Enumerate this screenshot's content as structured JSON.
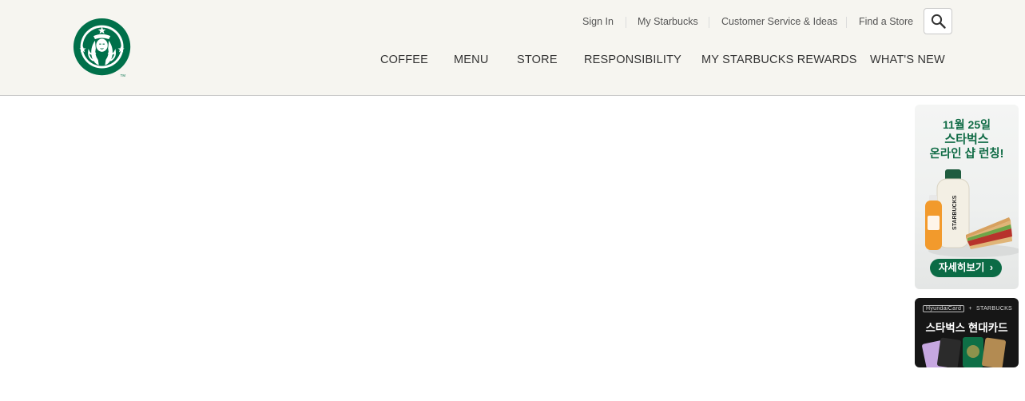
{
  "brand": {
    "logo_name": "starbucks-siren-logo",
    "green": "#00704a"
  },
  "util_nav": {
    "sign_in": "Sign In",
    "my_starbucks": "My Starbucks",
    "customer_service": "Customer Service & Ideas",
    "find_store": "Find a Store"
  },
  "search": {
    "icon": "search-icon"
  },
  "main_nav": {
    "coffee": "COFFEE",
    "menu": "MENU",
    "store": "STORE",
    "responsibility": "RESPONSIBILITY",
    "rewards": "MY STARBUCKS REWARDS",
    "whats_new": "WHAT'S NEW"
  },
  "banners": {
    "launch": {
      "line1": "11월 25일",
      "line2": "스타벅스",
      "line3": "온라인 샵 런칭!",
      "button": "자세히보기",
      "bottle_label": "STARBUCKS"
    },
    "card": {
      "partner": "HyundaiCard",
      "plus": "+",
      "brand": "STARBUCKS",
      "title": "스타벅스 현대카드"
    }
  }
}
